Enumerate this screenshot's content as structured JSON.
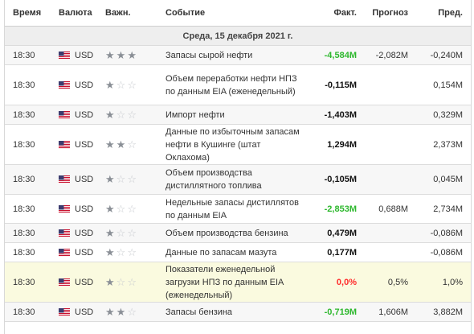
{
  "header": {
    "time": "Время",
    "currency": "Валюта",
    "importance": "Важн.",
    "event": "Событие",
    "actual": "Факт.",
    "forecast": "Прогноз",
    "previous": "Пред."
  },
  "date_label": "Среда, 15 декабря 2021 г.",
  "colors": {
    "positive": "#2eb82e",
    "negative": "#111111",
    "highlight": "#ff2a2a",
    "star_on": "#8a8f96",
    "star_off": "#c9ccd0"
  },
  "rows": [
    {
      "time": "18:30",
      "currency": "USD",
      "importance": 3,
      "event": "Запасы сырой нефти",
      "actual": "-4,584M",
      "actual_color": "positive",
      "forecast": "-2,082M",
      "previous": "-0,240M"
    },
    {
      "time": "18:30",
      "currency": "USD",
      "importance": 1,
      "event": "Объем переработки нефти НПЗ по данным EIA (еженедельный)",
      "actual": "-0,115M",
      "actual_color": "negative",
      "forecast": "",
      "previous": "0,154M"
    },
    {
      "time": "18:30",
      "currency": "USD",
      "importance": 1,
      "event": "Импорт нефти",
      "actual": "-1,403M",
      "actual_color": "negative",
      "forecast": "",
      "previous": "0,329M"
    },
    {
      "time": "18:30",
      "currency": "USD",
      "importance": 2,
      "event": "Данные по избыточным запасам нефти в Кушинге (штат Оклахома)",
      "actual": "1,294M",
      "actual_color": "negative",
      "forecast": "",
      "previous": "2,373M"
    },
    {
      "time": "18:30",
      "currency": "USD",
      "importance": 1,
      "event": "Объем производства дистиллятного топлива",
      "actual": "-0,105M",
      "actual_color": "negative",
      "forecast": "",
      "previous": "0,045M"
    },
    {
      "time": "18:30",
      "currency": "USD",
      "importance": 1,
      "event": "Недельные запасы дистиллятов по данным EIA",
      "actual": "-2,853M",
      "actual_color": "positive",
      "forecast": "0,688M",
      "previous": "2,734M"
    },
    {
      "time": "18:30",
      "currency": "USD",
      "importance": 1,
      "event": "Объем производства бензина",
      "actual": "0,479M",
      "actual_color": "negative",
      "forecast": "",
      "previous": "-0,086M"
    },
    {
      "time": "18:30",
      "currency": "USD",
      "importance": 1,
      "event": "Данные по запасам мазута",
      "actual": "0,177M",
      "actual_color": "negative",
      "forecast": "",
      "previous": "-0,086M"
    },
    {
      "time": "18:30",
      "currency": "USD",
      "importance": 1,
      "event": "Показатели еженедельной загрузки НПЗ по данным EIA (еженедельный)",
      "actual": "0,0%",
      "actual_color": "highlight",
      "forecast": "0,5%",
      "previous": "1,0%"
    },
    {
      "time": "18:30",
      "currency": "USD",
      "importance": 2,
      "event": "Запасы бензина",
      "actual": "-0,719M",
      "actual_color": "positive",
      "forecast": "1,606M",
      "previous": "3,882M"
    }
  ]
}
